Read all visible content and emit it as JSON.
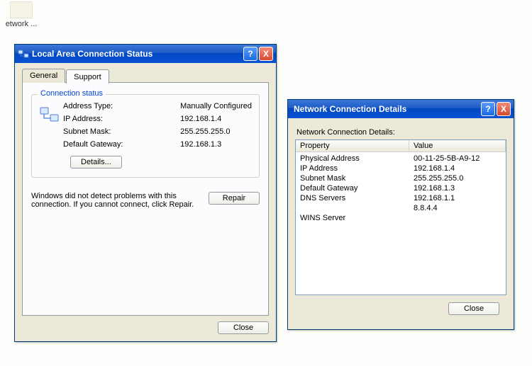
{
  "desktop": {
    "icon_label": "etwork ..."
  },
  "status_window": {
    "title": "Local Area Connection Status",
    "tabs": {
      "general": "General",
      "support": "Support"
    },
    "group_legend": "Connection status",
    "rows": {
      "addr_type_label": "Address Type:",
      "addr_type_value": "Manually Configured",
      "ip_label": "IP Address:",
      "ip_value": "192.168.1.4",
      "mask_label": "Subnet Mask:",
      "mask_value": "255.255.255.0",
      "gw_label": "Default Gateway:",
      "gw_value": "192.168.1.3"
    },
    "details_btn": "Details...",
    "diag_text": "Windows did not detect problems with this connection. If you cannot connect, click Repair.",
    "repair_btn": "Repair",
    "close_btn": "Close"
  },
  "details_window": {
    "title": "Network Connection Details",
    "list_label": "Network Connection Details:",
    "col_property": "Property",
    "col_value": "Value",
    "rows": [
      {
        "p": "Physical Address",
        "v": "00-11-25-5B-A9-12"
      },
      {
        "p": "IP Address",
        "v": "192.168.1.4"
      },
      {
        "p": "Subnet Mask",
        "v": "255.255.255.0"
      },
      {
        "p": "Default Gateway",
        "v": "192.168.1.3"
      },
      {
        "p": "DNS Servers",
        "v": "192.168.1.1"
      },
      {
        "p": "",
        "v": "8.8.4.4"
      },
      {
        "p": "WINS Server",
        "v": ""
      }
    ],
    "close_btn": "Close"
  },
  "icons": {
    "help": "?",
    "close": "X"
  }
}
